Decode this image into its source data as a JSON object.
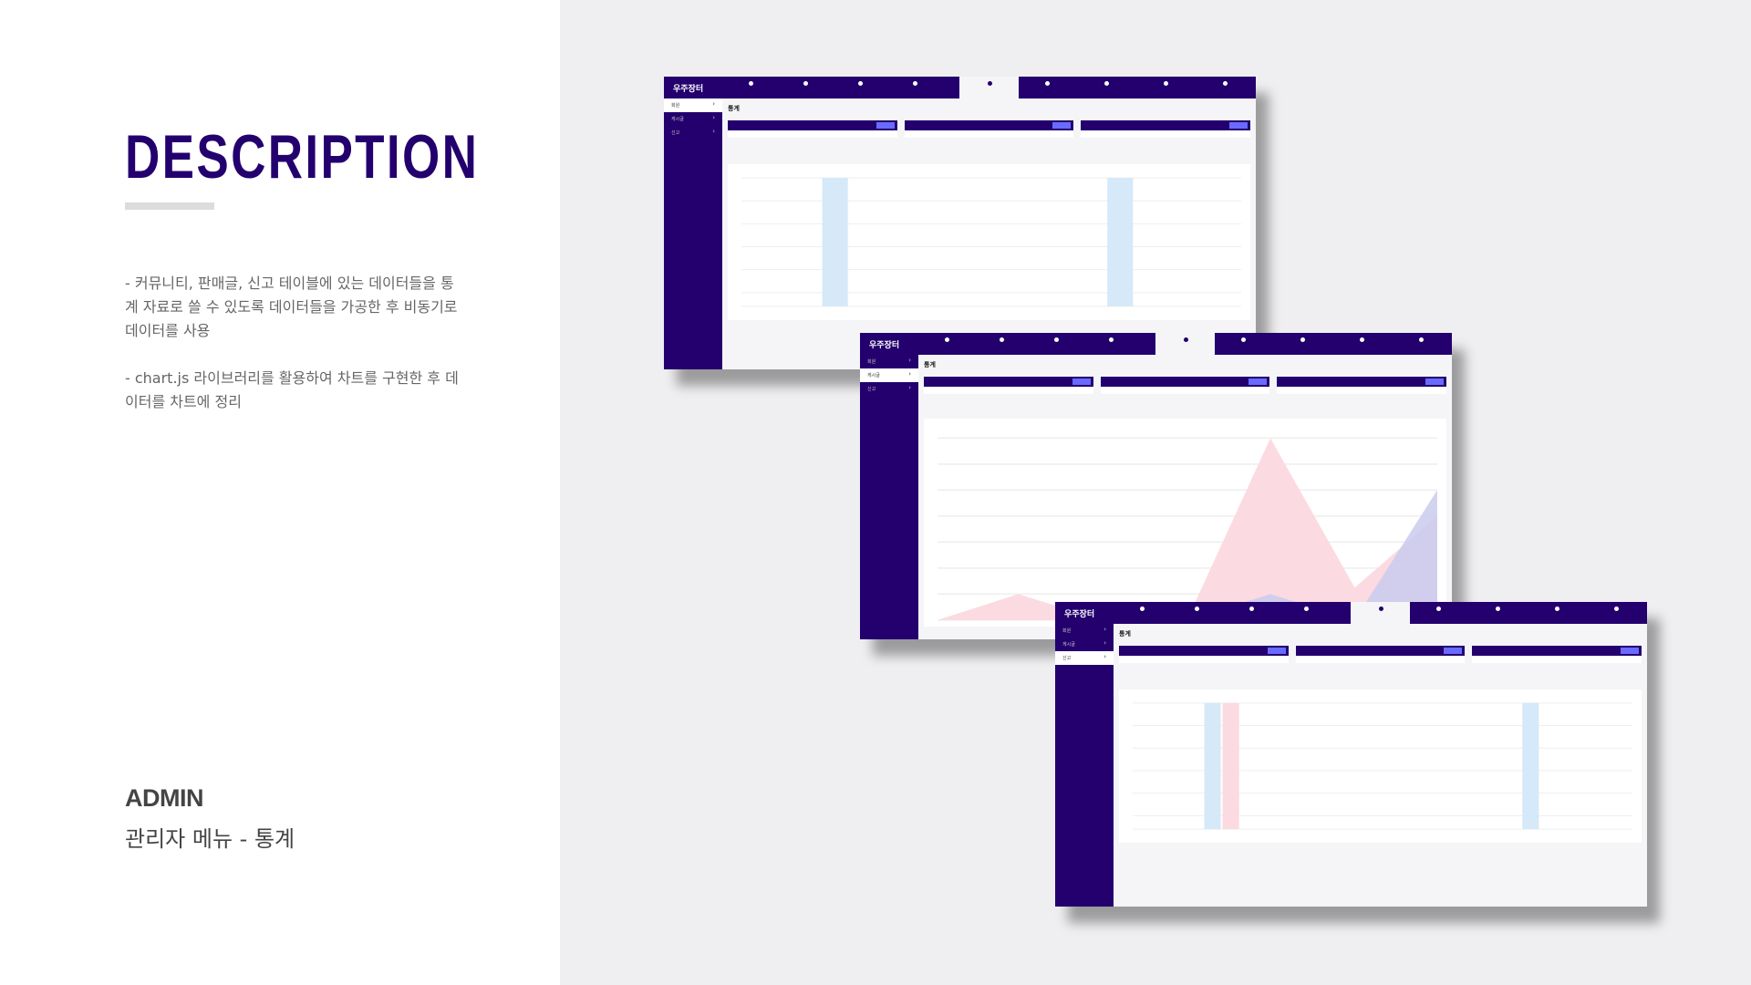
{
  "description": {
    "title": "DESCRIPTION",
    "para1": "- 커뮤니티, 판매글, 신고 테이블에 있는 데이터들을 통계 자료로 쓸 수 있도록 데이터들을 가공한 후 비동기로 데이터를 사용",
    "para2": "- chart.js 라이브러리를 활용하여 차트를 구현한 후 데이터를 차트에 정리"
  },
  "footer": {
    "title": "ADMIN",
    "subtitle": "관리자 메뉴 - 통계"
  },
  "mock": {
    "logo": "우주장터",
    "page_title": "통계",
    "sidebar": [
      "회원",
      "게시글",
      "신고"
    ],
    "colors": {
      "brand": "#23006e",
      "bar_blue": "#d6e9f8",
      "bar_pink": "#fbdbe1",
      "button": "#6a6aff"
    }
  }
}
